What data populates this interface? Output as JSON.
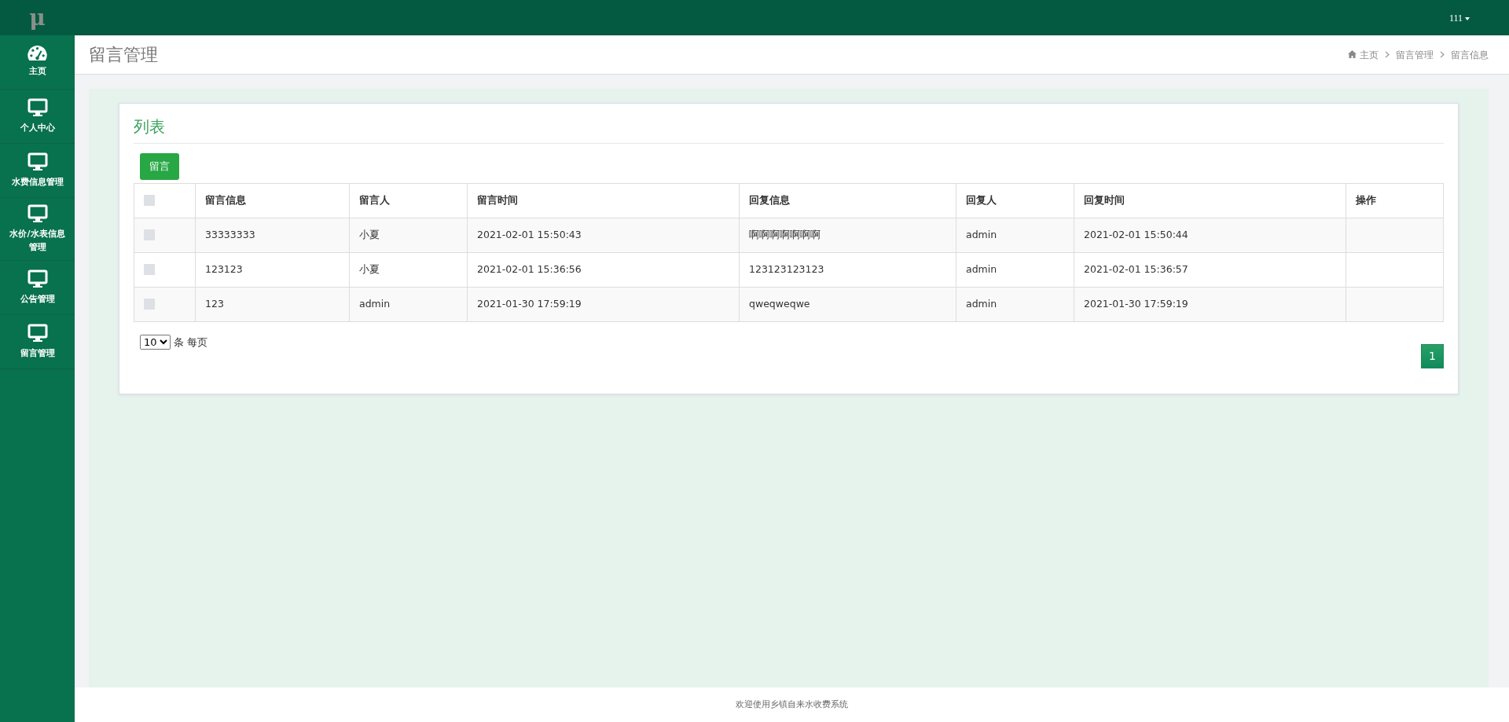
{
  "logo": "μ",
  "user_menu": {
    "label": "111"
  },
  "sidebar": {
    "items": [
      {
        "label": "主页",
        "kind": "dashboard"
      },
      {
        "label": "个人中心",
        "kind": "module"
      },
      {
        "label": "水费信息管理",
        "kind": "module"
      },
      {
        "label": "水价/水表信息管理",
        "kind": "module"
      },
      {
        "label": "公告管理",
        "kind": "module"
      },
      {
        "label": "留言管理",
        "kind": "module"
      }
    ]
  },
  "page_title": "留言管理",
  "breadcrumb": [
    "主页",
    "留言管理",
    "留言信息"
  ],
  "card": {
    "title": "列表",
    "add_button": "留言",
    "table": {
      "select_all": {
        "checked": false
      },
      "columns": [
        "留言信息",
        "留言人",
        "留言时间",
        "回复信息",
        "回复人",
        "回复时间",
        "操作"
      ],
      "rows": [
        {
          "checked": false,
          "cells": [
            "33333333",
            "小夏",
            "2021-02-01 15:50:43",
            "啊啊啊啊啊啊啊",
            "admin",
            "2021-02-01 15:50:44",
            ""
          ]
        },
        {
          "checked": false,
          "cells": [
            "123123",
            "小夏",
            "2021-02-01 15:36:56",
            "123123123123",
            "admin",
            "2021-02-01 15:36:57",
            ""
          ]
        },
        {
          "checked": false,
          "cells": [
            "123",
            "admin",
            "2021-01-30 17:59:19",
            "qweqweqwe",
            "admin",
            "2021-01-30 17:59:19",
            ""
          ]
        }
      ]
    },
    "page_size": {
      "value": "10",
      "label": "条 每页"
    },
    "pages": [
      {
        "label": "1",
        "selected": true
      }
    ]
  },
  "footer": "欢迎使用乡镇自来水收费系统"
}
